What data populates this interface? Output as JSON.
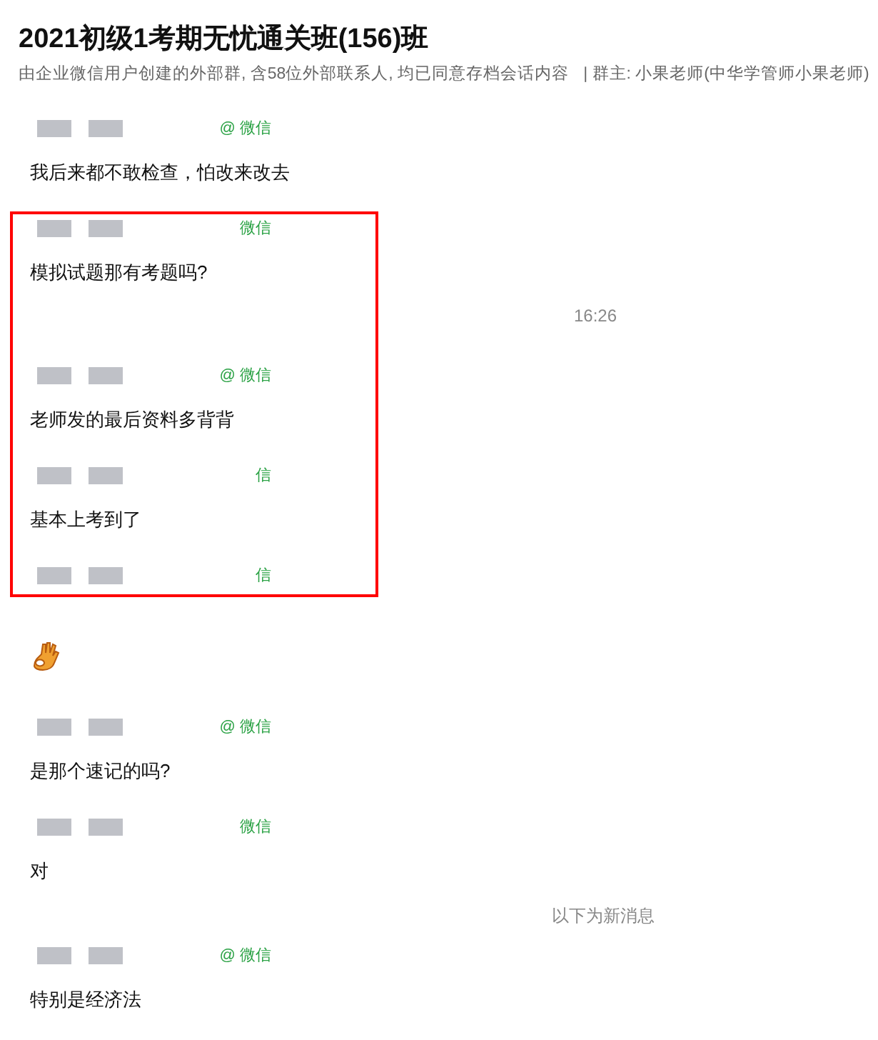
{
  "header": {
    "title": "2021初级1考期无忧通关班(156)班",
    "subtitle": "由企业微信用户创建的外部群, 含58位外部联系人, 均已同意存档会话内容",
    "owner": "| 群主: 小果老师(中华学管师小果老师)"
  },
  "feed": [
    {
      "kind": "message",
      "source": "@ 微信",
      "text": "我后来都不敢检查，怕改来改去"
    },
    {
      "kind": "highlight",
      "items": [
        {
          "kind": "message",
          "source": "微信",
          "text": "模拟试题那有考题吗?"
        },
        {
          "kind": "time",
          "text": "16:26"
        },
        {
          "kind": "message",
          "source": "@ 微信",
          "text": "老师发的最后资料多背背"
        },
        {
          "kind": "message",
          "source": "信",
          "text": "基本上考到了"
        },
        {
          "kind": "sender",
          "source": "信"
        }
      ]
    },
    {
      "kind": "emoji"
    },
    {
      "kind": "message",
      "source": "@ 微信",
      "text": "是那个速记的吗?"
    },
    {
      "kind": "message",
      "source": "微信",
      "text": "对"
    },
    {
      "kind": "divider",
      "text": "以下为新消息"
    },
    {
      "kind": "message",
      "source": "@ 微信",
      "text": "特别是经济法"
    }
  ]
}
